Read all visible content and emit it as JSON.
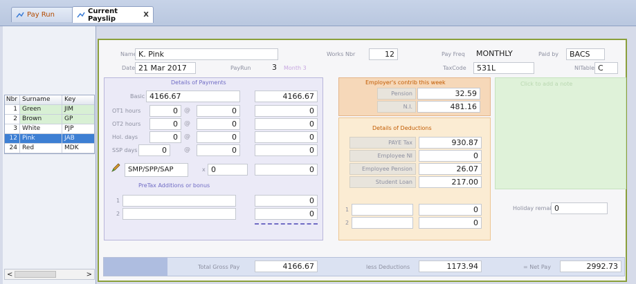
{
  "tabs": [
    {
      "label": "Pay Run"
    },
    {
      "label": "Current Payslip",
      "close": "X"
    }
  ],
  "employees_grid": {
    "columns": [
      "Nbr",
      "Surname",
      "Key"
    ],
    "rows": [
      {
        "nbr": "1",
        "surname": "Green",
        "key": "JIM"
      },
      {
        "nbr": "2",
        "surname": "Brown",
        "key": "GP"
      },
      {
        "nbr": "3",
        "surname": "White",
        "key": "PJP"
      },
      {
        "nbr": "12",
        "surname": "Pink",
        "key": "JAB"
      },
      {
        "nbr": "24",
        "surname": "Red",
        "key": "MDK"
      }
    ],
    "scroll_left": "<",
    "scroll_right": ">"
  },
  "header": {
    "name_label": "Name",
    "name": "K. Pink",
    "date_label": "Date",
    "date": "21 Mar 2017",
    "payrun_label": "PayRun",
    "payrun": "3",
    "month": "Month 3",
    "works_nbr_label": "Works Nbr",
    "works_nbr": "12",
    "pay_freq_label": "Pay Freq",
    "pay_freq": "MONTHLY",
    "paid_by_label": "Paid by",
    "paid_by": "BACS",
    "tax_code_label": "TaxCode",
    "tax_code": "531L",
    "ni_table_label": "NITable",
    "ni_table": "C"
  },
  "payments": {
    "title": "Details of Payments",
    "basic_label": "Basic",
    "basic": "4166.67",
    "basic_total": "4166.67",
    "ot1_label": "OT1 hours",
    "ot1_hours": "0",
    "ot1_rate": "0",
    "ot1_total": "0",
    "ot2_label": "OT2 hours",
    "ot2_hours": "0",
    "ot2_rate": "0",
    "ot2_total": "0",
    "hol_label": "Hol. days",
    "hol_days": "0",
    "hol_rate": "0",
    "hol_total": "0",
    "ssp_label": "SSP days",
    "ssp_days": "0",
    "ssp_rate": "0",
    "ssp_total": "0",
    "at": "@",
    "smp_label": "SMP/SPP/SAP",
    "smp_mult": "x",
    "smp_value": "0",
    "smp_total": "0",
    "pretax_title": "PreTax Additions or bonus",
    "add1_num": "1",
    "add1_total": "0",
    "add2_num": "2",
    "add2_total": "0"
  },
  "employer": {
    "title": "Employer's contrib this week",
    "pension_label": "Pension",
    "pension": "32.59",
    "ni_label": "N.I.",
    "ni": "481.16"
  },
  "deductions": {
    "title": "Details of Deductions",
    "paye_label": "PAYE Tax",
    "paye": "930.87",
    "employee_ni_label": "Employee NI",
    "employee_ni": "0",
    "employee_pension_label": "Employee Pension",
    "employee_pension": "26.07",
    "student_loan_label": "Student Loan",
    "student_loan": "217.00",
    "other1_num": "1",
    "other1": "0",
    "other2_num": "2",
    "other2": "0"
  },
  "notes_panel": {
    "title": "Click to add a note"
  },
  "holiday": {
    "label": "Holiday remain",
    "value": "0"
  },
  "totals": {
    "gross_label": "Total Gross Pay",
    "gross": "4166.67",
    "deductions_label": "less Deductions",
    "deductions": "1173.94",
    "net_label": "= Net Pay",
    "net": "2992.73"
  },
  "colors": {
    "accent_green": "#8a9f3a",
    "payments_bg": "#ebeaf7",
    "employer_bg": "#f6d8b9",
    "deductions_bg": "#fbecd3",
    "notes_bg": "#dff2d9",
    "selected_row": "#3d7fd3"
  }
}
